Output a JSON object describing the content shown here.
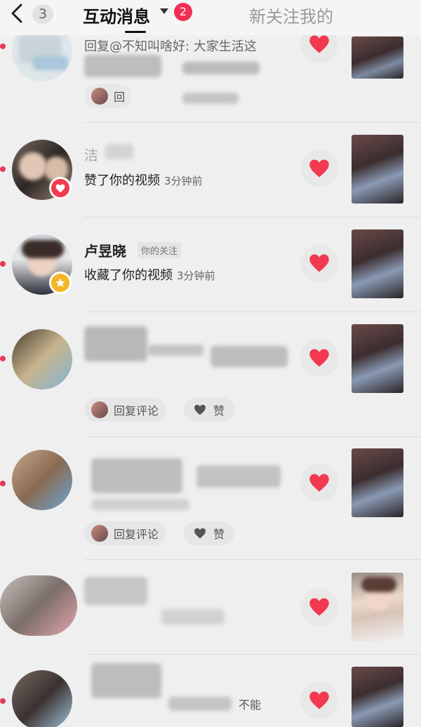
{
  "header": {
    "back_count": "3",
    "active_tab": "互动消息",
    "active_badge": "2",
    "other_tab": "新关注我的"
  },
  "rows": [
    {
      "name": "",
      "action": "回复@不知叫啥好: 大家生活这",
      "time": "",
      "chip_reply": "回",
      "chip_like": ""
    },
    {
      "name": "洁",
      "action": "赞了你的视频",
      "time": "3分钟前"
    },
    {
      "name": "卢昱晓",
      "tag": "你的关注",
      "action": "收藏了你的视频",
      "time": "3分钟前"
    },
    {
      "chip_reply": "回复评论",
      "chip_like": "赞"
    },
    {
      "chip_reply": "回复评论",
      "chip_like": "赞"
    },
    {},
    {
      "action_tail": "不能"
    }
  ],
  "colors": {
    "accent": "#f22e55",
    "heart": "#f2394f",
    "unread": "#e8395a"
  }
}
